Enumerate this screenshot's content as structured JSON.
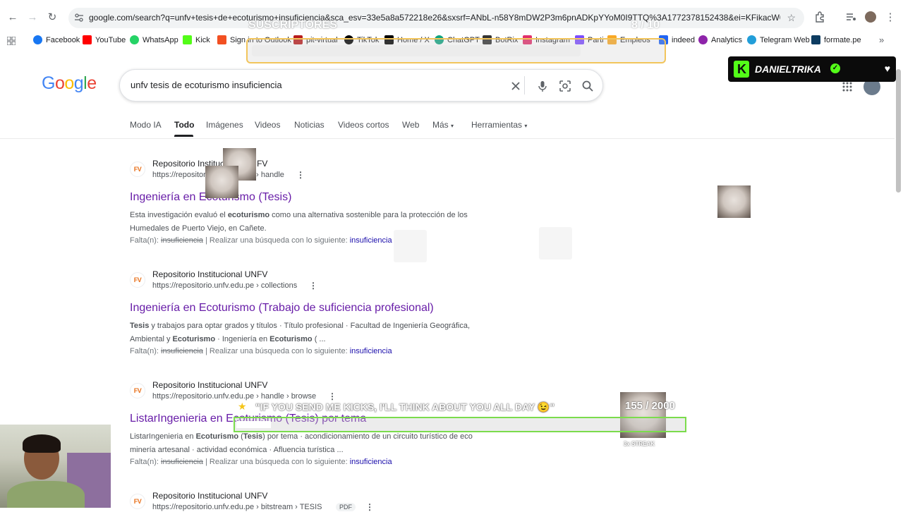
{
  "browser": {
    "url": "google.com/search?q=unfv+tesis+de+ecoturismo+insuficiencia&sca_esv=33e5a8a572218e26&sxsrf=ANbL-n58Y8mDW2P3m6pnADKpYYoM0I9TTQ%3A1772378152438&ei=KFikacW0GqjR1sQPh9r..."
  },
  "bookmarks": [
    {
      "label": "Facebook",
      "color": "#1877f2"
    },
    {
      "label": "YouTube",
      "color": "#ff0000"
    },
    {
      "label": "WhatsApp",
      "color": "#25d366"
    },
    {
      "label": "Kick",
      "color": "#53fc18"
    },
    {
      "label": "Sign in to Outlook",
      "color": "#f25022"
    },
    {
      "label": "pit-virtual",
      "color": "#b71c1c"
    },
    {
      "label": "TikTok",
      "color": "#000000"
    },
    {
      "label": "Home / X",
      "color": "#000000"
    },
    {
      "label": "ChatGPT",
      "color": "#10a37f"
    },
    {
      "label": "BotRix",
      "color": "#333333"
    },
    {
      "label": "Instagram",
      "color": "#e1306c"
    },
    {
      "label": "Parti",
      "color": "#7c4dff"
    },
    {
      "label": "Empleos",
      "color": "#f9a825"
    },
    {
      "label": "indeed",
      "color": "#2164f3"
    },
    {
      "label": "Analytics",
      "color": "#8e24aa"
    },
    {
      "label": "Telegram Web",
      "color": "#229ed9"
    },
    {
      "label": "formate.pe",
      "color": "#0d3c61"
    }
  ],
  "google": {
    "logo": "Google",
    "query": "unfv tesis de ecoturismo insuficiencia",
    "tabs": [
      "Modo IA",
      "Todo",
      "Imágenes",
      "Videos",
      "Noticias",
      "Videos cortos",
      "Web",
      "Más",
      "Herramientas"
    ]
  },
  "results": [
    {
      "site": "Repositorio Institucional UNFV",
      "url": "https://repositorio.unfv.edu.pe › handle",
      "title": "Ingeniería en Ecoturismo (Tesis)",
      "snippet_1": "Esta investigación evaluó el",
      "snippet_b1": "ecoturismo",
      "snippet_2": "como una alternativa sostenible para la protección de los Humedales de Puerto Viejo, en Cañete.",
      "missing_label": "Falta(n):",
      "missing_word": "insuficiencia",
      "missing_mid": "| Realizar una búsqueda con lo siguiente:",
      "missing_link": "insuficiencia"
    },
    {
      "site": "Repositorio Institucional UNFV",
      "url": "https://repositorio.unfv.edu.pe › collections",
      "title": "Ingeniería en Ecoturismo (Trabajo de suficiencia profesional)",
      "snippet_b0": "Tesis",
      "snippet_1": "y trabajos para optar grados y títulos · Título profesional · Facultad de Ingeniería Geográfica, Ambiental y",
      "snippet_b1": "Ecoturismo",
      "snippet_2": "· Ingeniería en",
      "snippet_b2": "Ecoturismo",
      "snippet_3": "( ...",
      "missing_label": "Falta(n):",
      "missing_word": "insuficiencia",
      "missing_mid": "| Realizar una búsqueda con lo siguiente:",
      "missing_link": "insuficiencia"
    },
    {
      "site": "Repositorio Institucional UNFV",
      "url": "https://repositorio.unfv.edu.pe › handle › browse",
      "title": "ListarIngenieria en Ecoturismo (Tesis) por tema",
      "snippet_1": "ListarIngenieria en",
      "snippet_b1": "Ecoturismo",
      "snippet_2": "(",
      "snippet_b2": "Tesis",
      "snippet_3": ") por tema · acondicionamiento de un circuito turístico de eco minería artesanal · actividad económica · Afluencia turística ...",
      "missing_label": "Falta(n):",
      "missing_word": "insuficiencia",
      "missing_mid": "| Realizar una búsqueda con lo siguiente:",
      "missing_link": "insuficiencia"
    },
    {
      "site": "Repositorio Institucional UNFV",
      "url": "https://repositorio.unfv.edu.pe › bitstream › TESIS",
      "badge": "PDF"
    }
  ],
  "overlays": {
    "subs_title": "SUSCRIPTORES",
    "subs_count": "8 / 10",
    "subs_progress": 0.8,
    "kick_user": "DANIELTRIKA",
    "kicks_text": "\"IF YOU SEND ME KICKS, I'LL THINK ABOUT YOU ALL DAY 😉\"",
    "kicks_count": "155 / 2000",
    "kicks_progress": 0.0775,
    "streak": "3x STREAK"
  }
}
